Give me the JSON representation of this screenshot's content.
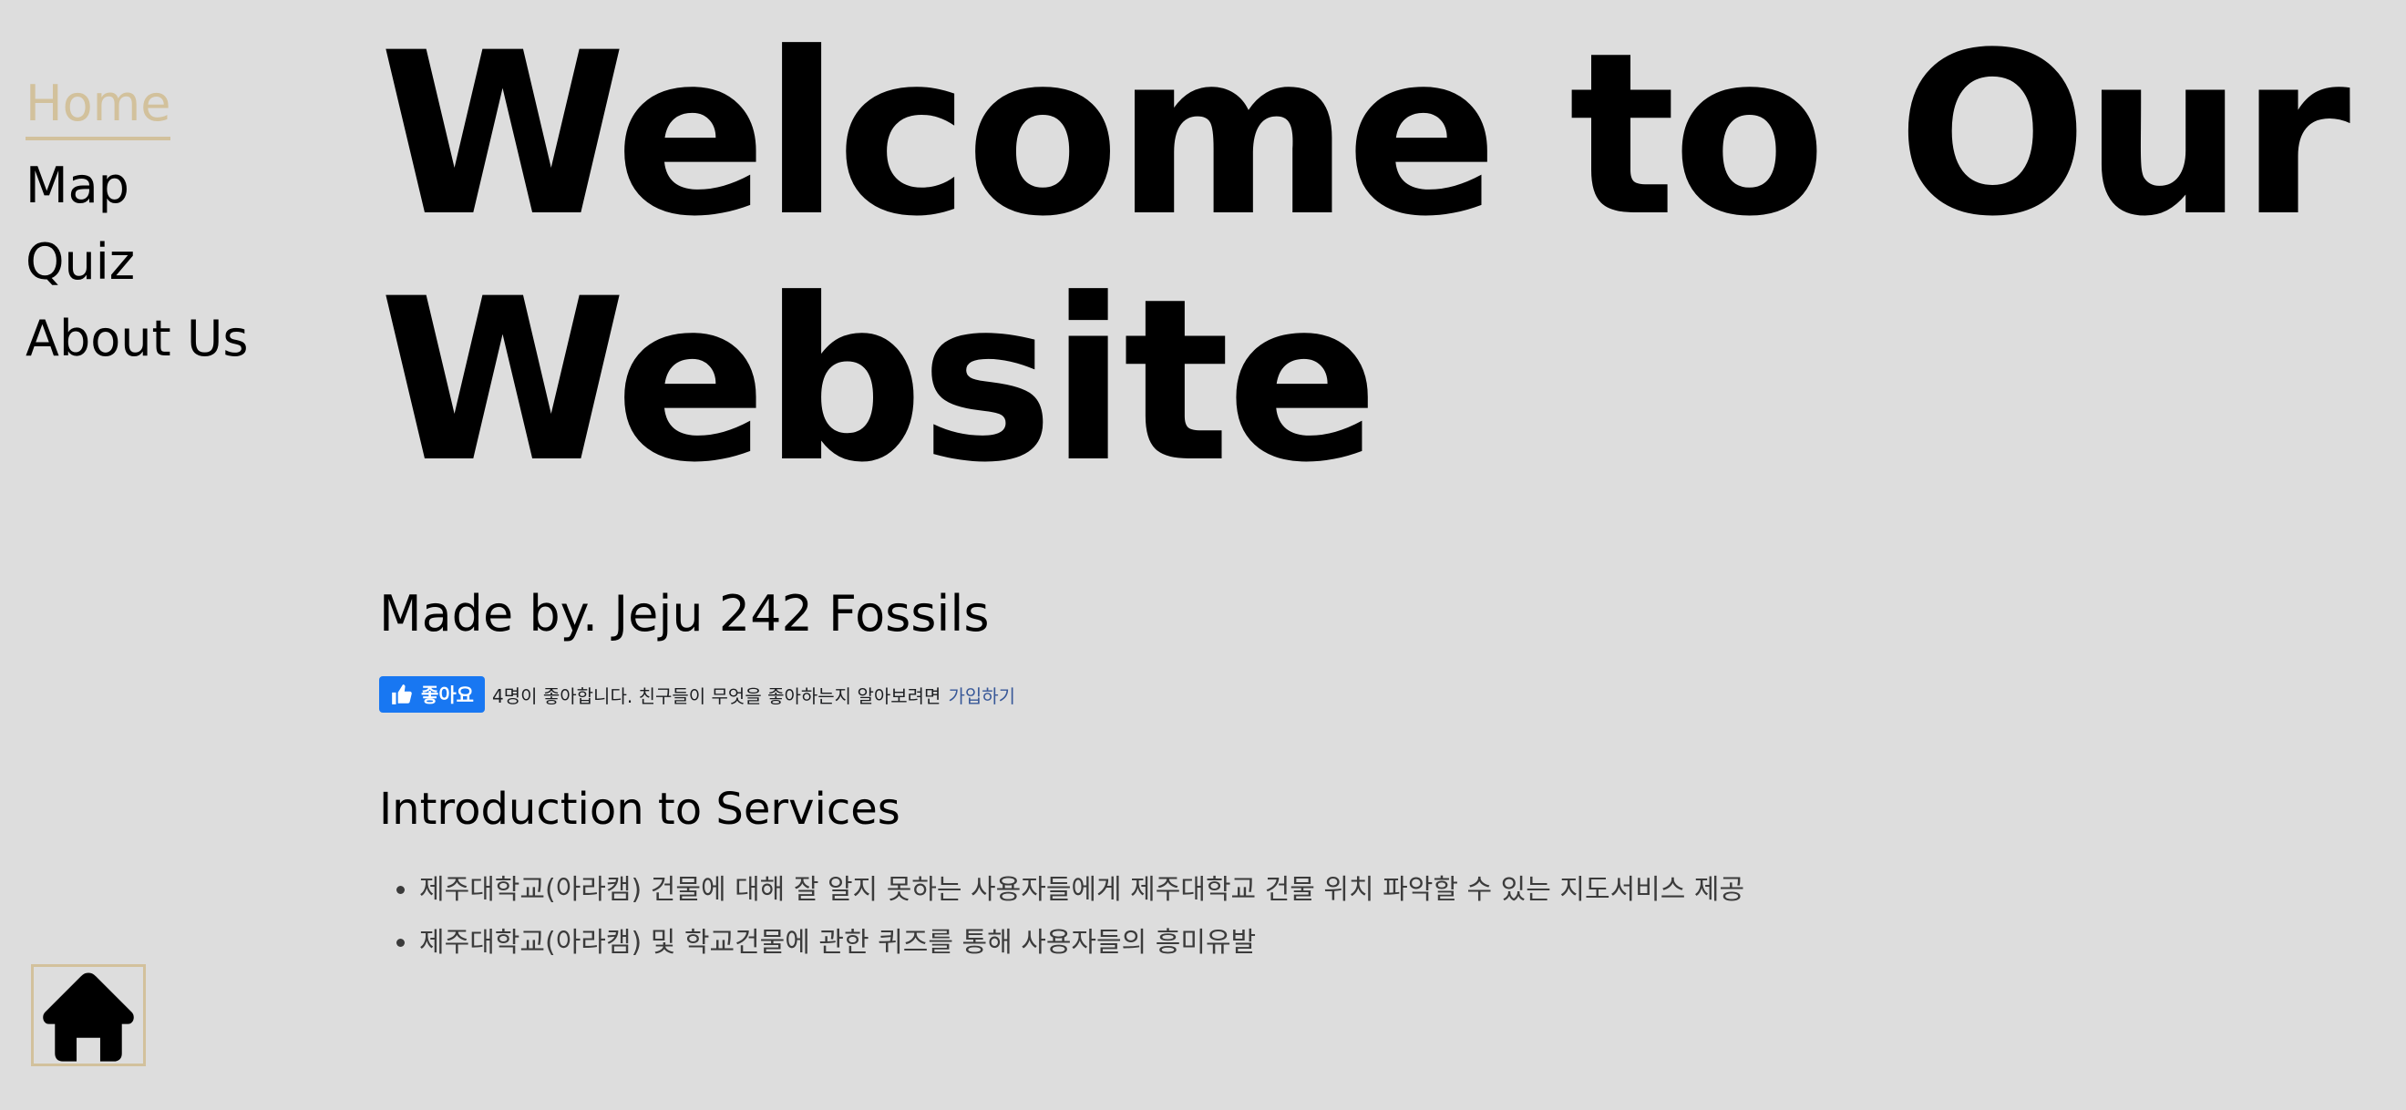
{
  "nav": {
    "items": [
      {
        "label": "Home",
        "active": true
      },
      {
        "label": "Map",
        "active": false
      },
      {
        "label": "Quiz",
        "active": false
      },
      {
        "label": "About Us",
        "active": false
      }
    ]
  },
  "hero": {
    "title_line1": "Welcome to Our",
    "title_line2": "Website"
  },
  "made_by": "Made by. Jeju 242 Fossils",
  "facebook_like": {
    "button_label": "좋아요",
    "count_text": "4명이 좋아합니다. 친구들이 무엇을 좋아하는지 알아보려면",
    "signup_link": "가입하기",
    "icon": "thumbs-up-icon",
    "color": "#1877f2"
  },
  "services": {
    "heading": "Introduction to Services",
    "items": [
      "제주대학교(아라캠) 건물에 대해 잘 알지 못하는 사용자들에게 제주대학교 건물 위치 파악할 수 있는 지도서비스 제공",
      "제주대학교(아라캠) 및 학교건물에 관한 퀴즈를 통해 사용자들의 흥미유발"
    ]
  },
  "home_button": {
    "icon": "home-icon"
  },
  "colors": {
    "background": "#dddddd",
    "accent": "#d2c19c",
    "text": "#000000",
    "facebook_blue": "#1877f2"
  }
}
